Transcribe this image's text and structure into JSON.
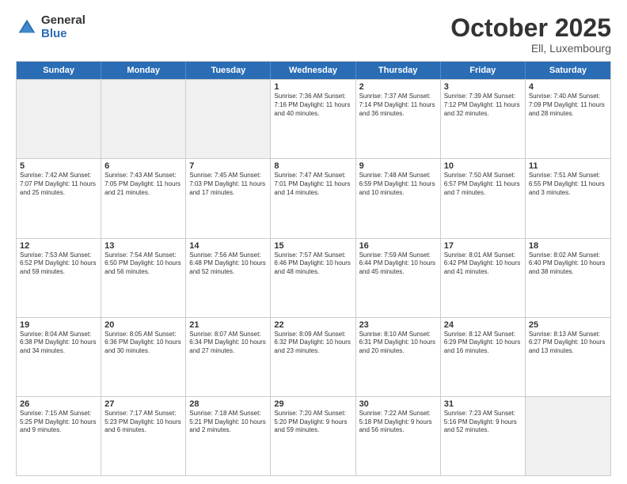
{
  "header": {
    "logo_general": "General",
    "logo_blue": "Blue",
    "month": "October 2025",
    "location": "Ell, Luxembourg"
  },
  "weekdays": [
    "Sunday",
    "Monday",
    "Tuesday",
    "Wednesday",
    "Thursday",
    "Friday",
    "Saturday"
  ],
  "weeks": [
    [
      {
        "day": "",
        "info": "",
        "shaded": true
      },
      {
        "day": "",
        "info": "",
        "shaded": true
      },
      {
        "day": "",
        "info": "",
        "shaded": true
      },
      {
        "day": "1",
        "info": "Sunrise: 7:36 AM\nSunset: 7:16 PM\nDaylight: 11 hours\nand 40 minutes.",
        "shaded": false
      },
      {
        "day": "2",
        "info": "Sunrise: 7:37 AM\nSunset: 7:14 PM\nDaylight: 11 hours\nand 36 minutes.",
        "shaded": false
      },
      {
        "day": "3",
        "info": "Sunrise: 7:39 AM\nSunset: 7:12 PM\nDaylight: 11 hours\nand 32 minutes.",
        "shaded": false
      },
      {
        "day": "4",
        "info": "Sunrise: 7:40 AM\nSunset: 7:09 PM\nDaylight: 11 hours\nand 28 minutes.",
        "shaded": false
      }
    ],
    [
      {
        "day": "5",
        "info": "Sunrise: 7:42 AM\nSunset: 7:07 PM\nDaylight: 11 hours\nand 25 minutes.",
        "shaded": false
      },
      {
        "day": "6",
        "info": "Sunrise: 7:43 AM\nSunset: 7:05 PM\nDaylight: 11 hours\nand 21 minutes.",
        "shaded": false
      },
      {
        "day": "7",
        "info": "Sunrise: 7:45 AM\nSunset: 7:03 PM\nDaylight: 11 hours\nand 17 minutes.",
        "shaded": false
      },
      {
        "day": "8",
        "info": "Sunrise: 7:47 AM\nSunset: 7:01 PM\nDaylight: 11 hours\nand 14 minutes.",
        "shaded": false
      },
      {
        "day": "9",
        "info": "Sunrise: 7:48 AM\nSunset: 6:59 PM\nDaylight: 11 hours\nand 10 minutes.",
        "shaded": false
      },
      {
        "day": "10",
        "info": "Sunrise: 7:50 AM\nSunset: 6:57 PM\nDaylight: 11 hours\nand 7 minutes.",
        "shaded": false
      },
      {
        "day": "11",
        "info": "Sunrise: 7:51 AM\nSunset: 6:55 PM\nDaylight: 11 hours\nand 3 minutes.",
        "shaded": false
      }
    ],
    [
      {
        "day": "12",
        "info": "Sunrise: 7:53 AM\nSunset: 6:52 PM\nDaylight: 10 hours\nand 59 minutes.",
        "shaded": false
      },
      {
        "day": "13",
        "info": "Sunrise: 7:54 AM\nSunset: 6:50 PM\nDaylight: 10 hours\nand 56 minutes.",
        "shaded": false
      },
      {
        "day": "14",
        "info": "Sunrise: 7:56 AM\nSunset: 6:48 PM\nDaylight: 10 hours\nand 52 minutes.",
        "shaded": false
      },
      {
        "day": "15",
        "info": "Sunrise: 7:57 AM\nSunset: 6:46 PM\nDaylight: 10 hours\nand 48 minutes.",
        "shaded": false
      },
      {
        "day": "16",
        "info": "Sunrise: 7:59 AM\nSunset: 6:44 PM\nDaylight: 10 hours\nand 45 minutes.",
        "shaded": false
      },
      {
        "day": "17",
        "info": "Sunrise: 8:01 AM\nSunset: 6:42 PM\nDaylight: 10 hours\nand 41 minutes.",
        "shaded": false
      },
      {
        "day": "18",
        "info": "Sunrise: 8:02 AM\nSunset: 6:40 PM\nDaylight: 10 hours\nand 38 minutes.",
        "shaded": false
      }
    ],
    [
      {
        "day": "19",
        "info": "Sunrise: 8:04 AM\nSunset: 6:38 PM\nDaylight: 10 hours\nand 34 minutes.",
        "shaded": false
      },
      {
        "day": "20",
        "info": "Sunrise: 8:05 AM\nSunset: 6:36 PM\nDaylight: 10 hours\nand 30 minutes.",
        "shaded": false
      },
      {
        "day": "21",
        "info": "Sunrise: 8:07 AM\nSunset: 6:34 PM\nDaylight: 10 hours\nand 27 minutes.",
        "shaded": false
      },
      {
        "day": "22",
        "info": "Sunrise: 8:09 AM\nSunset: 6:32 PM\nDaylight: 10 hours\nand 23 minutes.",
        "shaded": false
      },
      {
        "day": "23",
        "info": "Sunrise: 8:10 AM\nSunset: 6:31 PM\nDaylight: 10 hours\nand 20 minutes.",
        "shaded": false
      },
      {
        "day": "24",
        "info": "Sunrise: 8:12 AM\nSunset: 6:29 PM\nDaylight: 10 hours\nand 16 minutes.",
        "shaded": false
      },
      {
        "day": "25",
        "info": "Sunrise: 8:13 AM\nSunset: 6:27 PM\nDaylight: 10 hours\nand 13 minutes.",
        "shaded": false
      }
    ],
    [
      {
        "day": "26",
        "info": "Sunrise: 7:15 AM\nSunset: 5:25 PM\nDaylight: 10 hours\nand 9 minutes.",
        "shaded": false
      },
      {
        "day": "27",
        "info": "Sunrise: 7:17 AM\nSunset: 5:23 PM\nDaylight: 10 hours\nand 6 minutes.",
        "shaded": false
      },
      {
        "day": "28",
        "info": "Sunrise: 7:18 AM\nSunset: 5:21 PM\nDaylight: 10 hours\nand 2 minutes.",
        "shaded": false
      },
      {
        "day": "29",
        "info": "Sunrise: 7:20 AM\nSunset: 5:20 PM\nDaylight: 9 hours\nand 59 minutes.",
        "shaded": false
      },
      {
        "day": "30",
        "info": "Sunrise: 7:22 AM\nSunset: 5:18 PM\nDaylight: 9 hours\nand 56 minutes.",
        "shaded": false
      },
      {
        "day": "31",
        "info": "Sunrise: 7:23 AM\nSunset: 5:16 PM\nDaylight: 9 hours\nand 52 minutes.",
        "shaded": false
      },
      {
        "day": "",
        "info": "",
        "shaded": true
      }
    ]
  ]
}
